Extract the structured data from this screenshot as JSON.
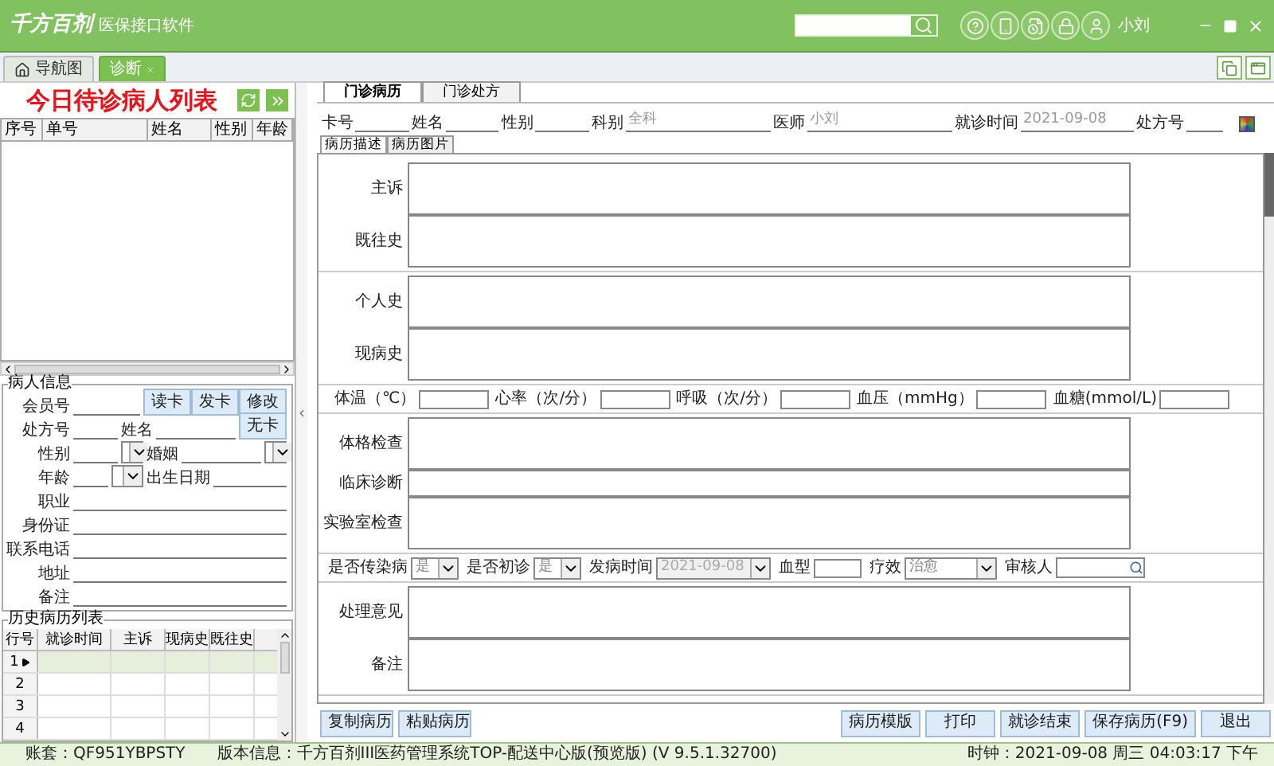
{
  "app": {
    "logo": "千方百剂",
    "product": "医保接口软件",
    "user": "小刘"
  },
  "tabs": [
    {
      "label": "导航图",
      "kind": "home",
      "selected": false
    },
    {
      "label": "诊断",
      "kind": "closable",
      "selected": true
    }
  ],
  "waiting_list": {
    "title": "今日待诊病人列表",
    "columns": [
      "序号",
      "单号",
      "姓名",
      "性别",
      "年龄"
    ]
  },
  "patient_info": {
    "legend": "病人信息",
    "buttons": [
      "读卡",
      "发卡",
      "修改"
    ],
    "no_card_button": "无卡",
    "rows": [
      [
        {
          "label": "会员号",
          "kind": "text"
        }
      ],
      [
        {
          "label": "处方号",
          "kind": "text"
        },
        {
          "label": "姓名",
          "kind": "text"
        }
      ],
      [
        {
          "label": "性别",
          "kind": "select"
        },
        {
          "label": "婚姻",
          "kind": "select"
        }
      ],
      [
        {
          "label": "年龄",
          "kind": "age"
        },
        {
          "label": "出生日期",
          "kind": "text"
        }
      ],
      [
        {
          "label": "职业",
          "kind": "text"
        }
      ],
      [
        {
          "label": "身份证",
          "kind": "text"
        }
      ],
      [
        {
          "label": "联系电话",
          "kind": "text"
        }
      ],
      [
        {
          "label": "地址",
          "kind": "text"
        }
      ],
      [
        {
          "label": "备注",
          "kind": "text"
        }
      ]
    ]
  },
  "history": {
    "legend": "历史病历列表",
    "columns": [
      "行号",
      "就诊时间",
      "主诉",
      "现病史",
      "既往史"
    ],
    "rows": [
      {
        "number": "1",
        "selected": true
      },
      {
        "number": "2",
        "selected": false
      },
      {
        "number": "3",
        "selected": false
      },
      {
        "number": "4",
        "selected": false
      }
    ]
  },
  "record_tabs": [
    {
      "label": "门诊病历",
      "selected": true
    },
    {
      "label": "门诊处方",
      "selected": false
    }
  ],
  "header_fields": [
    {
      "label": "卡号"
    },
    {
      "label": "姓名"
    },
    {
      "label": "性别"
    },
    {
      "label": "科别",
      "value": "全科"
    },
    {
      "label": "医师",
      "value": "小刘"
    },
    {
      "label": "就诊时间",
      "value": "2021-09-08"
    },
    {
      "label": "处方号"
    }
  ],
  "sub_tabs": [
    {
      "label": "病历描述",
      "selected": true
    },
    {
      "label": "病历图片",
      "selected": false
    }
  ],
  "sections": [
    {
      "kind": "notes",
      "fields": [
        {
          "label": "主诉",
          "kind": "tall"
        },
        {
          "label": "既往史",
          "kind": "tall"
        }
      ]
    },
    {
      "kind": "notes",
      "fields": [
        {
          "label": "个人史",
          "kind": "tall"
        },
        {
          "label": "现病史",
          "kind": "tall"
        }
      ]
    },
    {
      "kind": "vitals",
      "fields": [
        {
          "label": "体温（℃）"
        },
        {
          "label": "心率（次/分）"
        },
        {
          "label": "呼吸（次/分）"
        },
        {
          "label": "血压（mmHg）"
        },
        {
          "label": "血糖(mmol/L)"
        }
      ]
    },
    {
      "kind": "notes",
      "fields": [
        {
          "label": "体格检查",
          "kind": "tall"
        },
        {
          "label": "临床诊断",
          "kind": "short"
        },
        {
          "label": "实验室检查",
          "kind": "tall"
        }
      ]
    },
    {
      "kind": "options",
      "fields": [
        {
          "label": "是否传染病",
          "kind": "select",
          "value": "是"
        },
        {
          "label": "是否初诊",
          "kind": "select",
          "value": "是"
        },
        {
          "label": "发病时间",
          "kind": "date",
          "value": "2021-09-08",
          "disabled": true
        },
        {
          "label": "血型",
          "kind": "text"
        },
        {
          "label": "疗效",
          "kind": "select",
          "value": "治愈"
        },
        {
          "label": "审核人",
          "kind": "lookup"
        }
      ]
    },
    {
      "kind": "notes",
      "fields": [
        {
          "label": "处理意见",
          "kind": "tall"
        },
        {
          "label": "备注",
          "kind": "tall"
        }
      ]
    }
  ],
  "left_buttons": [
    "复制病历",
    "粘贴病历"
  ],
  "right_buttons": [
    "病历模版",
    "打印",
    "就诊结束",
    "保存病历(F9)",
    "退出"
  ],
  "status_bar": {
    "account": "账套：QF951YBPSTY",
    "version": "版本信息：千方百剂III医药管理系统TOP-配送中心版(预览版) (V 9.5.1.32700)",
    "clock": "时钟：2021-09-08 周三 04:03:17 下午"
  }
}
